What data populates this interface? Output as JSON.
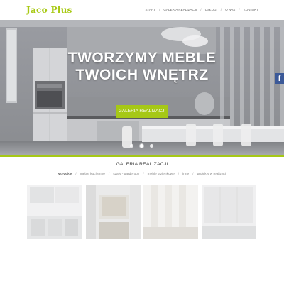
{
  "header": {
    "logo": "Jaco Plus",
    "nav": [
      {
        "label": "START"
      },
      {
        "label": "GALERIA REALIZACJI"
      },
      {
        "label": "USŁUGI"
      },
      {
        "label": "O NAS"
      },
      {
        "label": "KONTAKT"
      }
    ]
  },
  "hero": {
    "title_line1": "TWORZYMY MEBLE",
    "title_line2": "TWOICH WNĘTRZ",
    "button_label": "GALERIA REALIZACJI",
    "slides_count": 3,
    "active_slide": 1
  },
  "social": {
    "facebook_icon": "f"
  },
  "gallery": {
    "title": "GALERIA REALIZACJI",
    "filters": [
      {
        "label": "wszystkie",
        "active": true
      },
      {
        "label": "meble kuchenne"
      },
      {
        "label": "szafy - garderoby"
      },
      {
        "label": "meble łazienkowe"
      },
      {
        "label": "inne"
      },
      {
        "label": "projekty w realizacji"
      }
    ]
  },
  "colors": {
    "accent": "#a6c816",
    "facebook": "#3b5998",
    "text": "#444444"
  }
}
